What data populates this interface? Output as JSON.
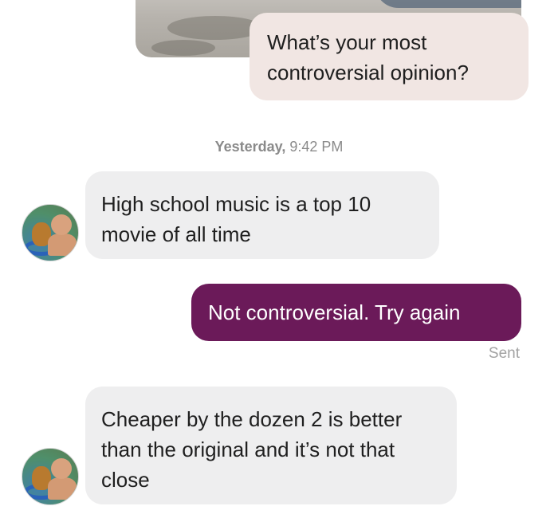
{
  "conversation": {
    "prompt": {
      "text": "What’s your most controversial opinion?"
    },
    "timestamp": {
      "day": "Yesterday,",
      "time": "9:42 PM"
    },
    "messages": [
      {
        "sender": "them",
        "text": "High school music is a top 10 movie of all time"
      },
      {
        "sender": "me",
        "text": "Not controversial. Try again",
        "status": "Sent"
      },
      {
        "sender": "them",
        "text": "Cheaper by the dozen 2 is better than the original and it’s not that close"
      }
    ]
  },
  "colors": {
    "sent_bubble": "#6b1a59",
    "received_bubble": "#eeeeef",
    "prompt_bubble": "#f1e6e3"
  },
  "icons": {
    "avatar": "profile-photo-avatar"
  }
}
